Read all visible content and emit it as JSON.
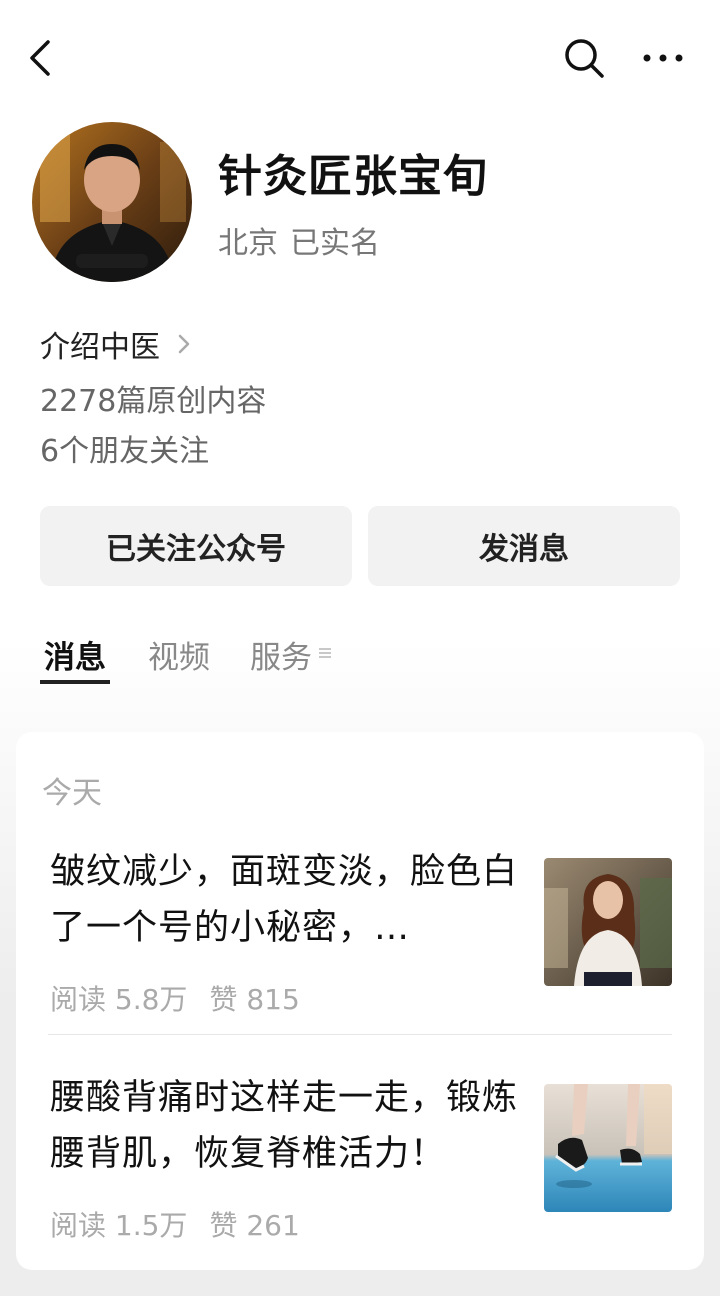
{
  "header": {
    "back_icon": "chevron-left-icon",
    "search_icon": "search-icon",
    "more_icon": "more-horizontal-icon"
  },
  "profile": {
    "name": "针灸匠张宝旬",
    "location": "北京",
    "verified": "已实名",
    "intro": "介绍中医",
    "original_count": "2278篇原创内容",
    "friends_following": "6个朋友关注"
  },
  "actions": {
    "follow_label": "已关注公众号",
    "message_label": "发消息"
  },
  "tabs": [
    {
      "label": "消息"
    },
    {
      "label": "视频"
    },
    {
      "label": "服务"
    }
  ],
  "feed": {
    "section_label": "今天",
    "articles": [
      {
        "title": "皱纹减少，面斑变淡，脸色白了一个号的小秘密，…",
        "reads": "阅读 5.8万",
        "likes": "赞 815"
      },
      {
        "title": "腰酸背痛时这样走一走，锻炼腰背肌，恢复脊椎活力！",
        "reads": "阅读 1.5万",
        "likes": "赞 261"
      }
    ]
  },
  "colors": {
    "text_primary": "#111111",
    "text_secondary": "#777777",
    "button_bg": "#f2f2f2",
    "page_bg": "#ededed"
  }
}
